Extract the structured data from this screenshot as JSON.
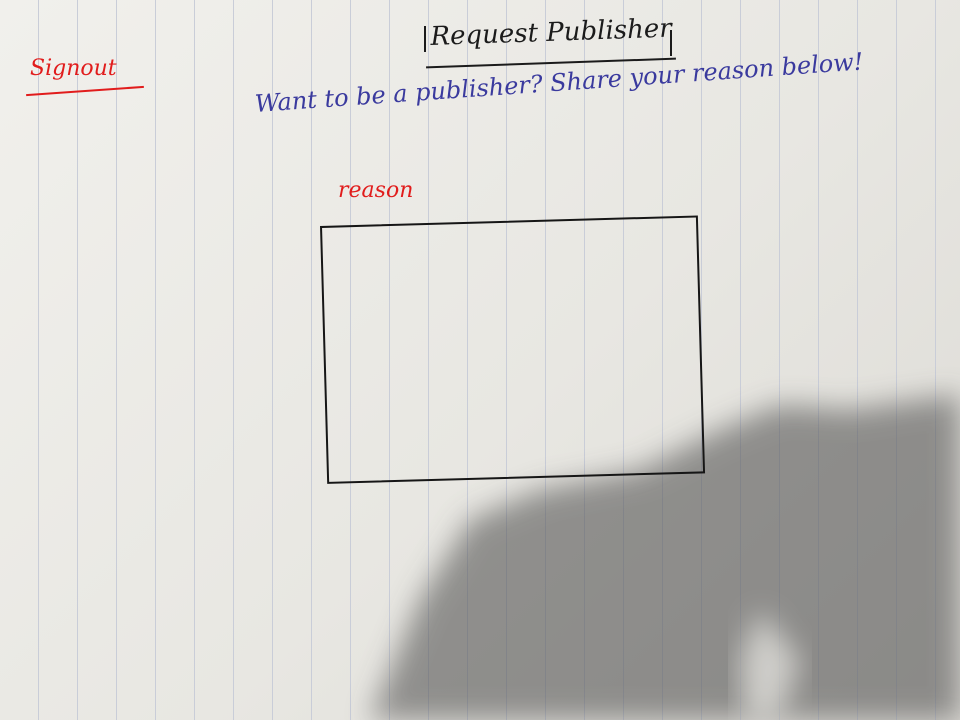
{
  "header": {
    "title": "Request Publisher"
  },
  "nav": {
    "signout_label": "Signout"
  },
  "form": {
    "prompt": "Want to be a publisher? Share your reason below!",
    "reason_label": "reason",
    "reason_value": "",
    "reason_placeholder": ""
  },
  "colors": {
    "ink_black": "#1b1b1b",
    "ink_red": "#e11c1c",
    "ink_blue": "#3a3a9e",
    "paper": "#ecebe6"
  }
}
